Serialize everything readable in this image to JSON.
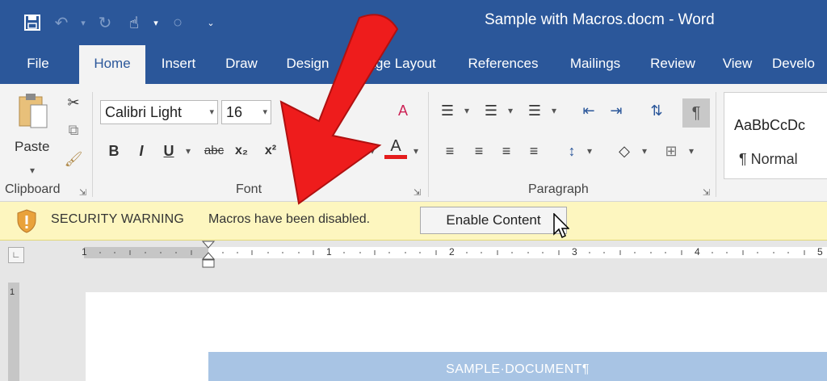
{
  "window": {
    "title": "Sample with Macros.docm - Word"
  },
  "quick_access": [
    {
      "name": "save-icon",
      "glyph": "💾"
    },
    {
      "name": "undo-icon",
      "glyph": "↶"
    },
    {
      "name": "redo-icon",
      "glyph": "↻"
    },
    {
      "name": "touch-mode-icon",
      "glyph": "☝"
    },
    {
      "name": "circle-icon",
      "glyph": "○"
    },
    {
      "name": "customize-qat-icon",
      "glyph": "⌄"
    }
  ],
  "tabs": [
    "File",
    "Home",
    "Insert",
    "Draw",
    "Design",
    "Page Layout",
    "References",
    "Mailings",
    "Review",
    "View",
    "Develo"
  ],
  "active_tab": "Home",
  "ribbon": {
    "clipboard": {
      "paste_label": "Paste",
      "group_label": "Clipboard"
    },
    "font": {
      "font_name": "Calibri Light",
      "font_size": "16",
      "bold": "B",
      "italic": "I",
      "underline": "U",
      "strikethrough": "abc",
      "subscript": "x₂",
      "superscript": "x²",
      "grow_font": "A",
      "font_color": "A",
      "group_label": "Font"
    },
    "paragraph": {
      "show_marks": "¶",
      "group_label": "Paragraph"
    },
    "styles": {
      "preview": "AaBbCcDc",
      "name": "¶ Normal"
    }
  },
  "security_bar": {
    "title": "SECURITY WARNING",
    "message": "Macros have been disabled.",
    "button": "Enable Content"
  },
  "ruler": {
    "numbers": [
      "1",
      "1",
      "2",
      "3",
      "4",
      "5"
    ],
    "vertical_number": "1"
  },
  "document": {
    "heading": "SAMPLE·DOCUMENT¶"
  },
  "colors": {
    "brand": "#2b579a",
    "security_bar": "#fdf6bf",
    "arrow": "#ee1c1c",
    "highlight": "#ffff00",
    "font_color_underline": "#e41c1c"
  }
}
